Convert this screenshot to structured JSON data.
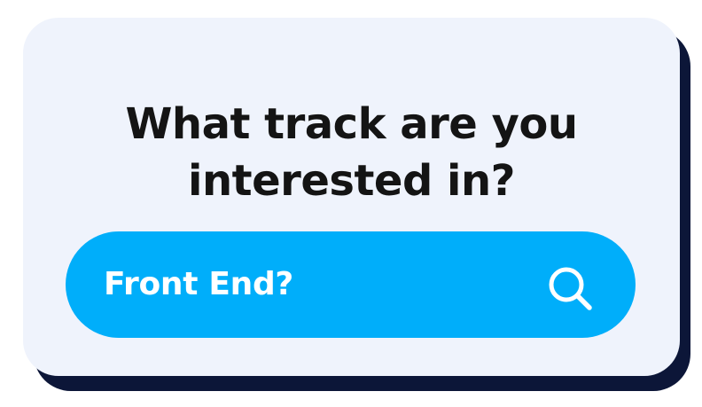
{
  "prompt": {
    "line1": "What track are you",
    "line2": "interested in?"
  },
  "search": {
    "value": "Front End?",
    "icon": "search-icon"
  },
  "colors": {
    "card_background": "#eff3fc",
    "card_shadow": "#0c1638",
    "search_background": "#00aefa",
    "search_text": "#ffffff",
    "heading_text": "#141414"
  }
}
